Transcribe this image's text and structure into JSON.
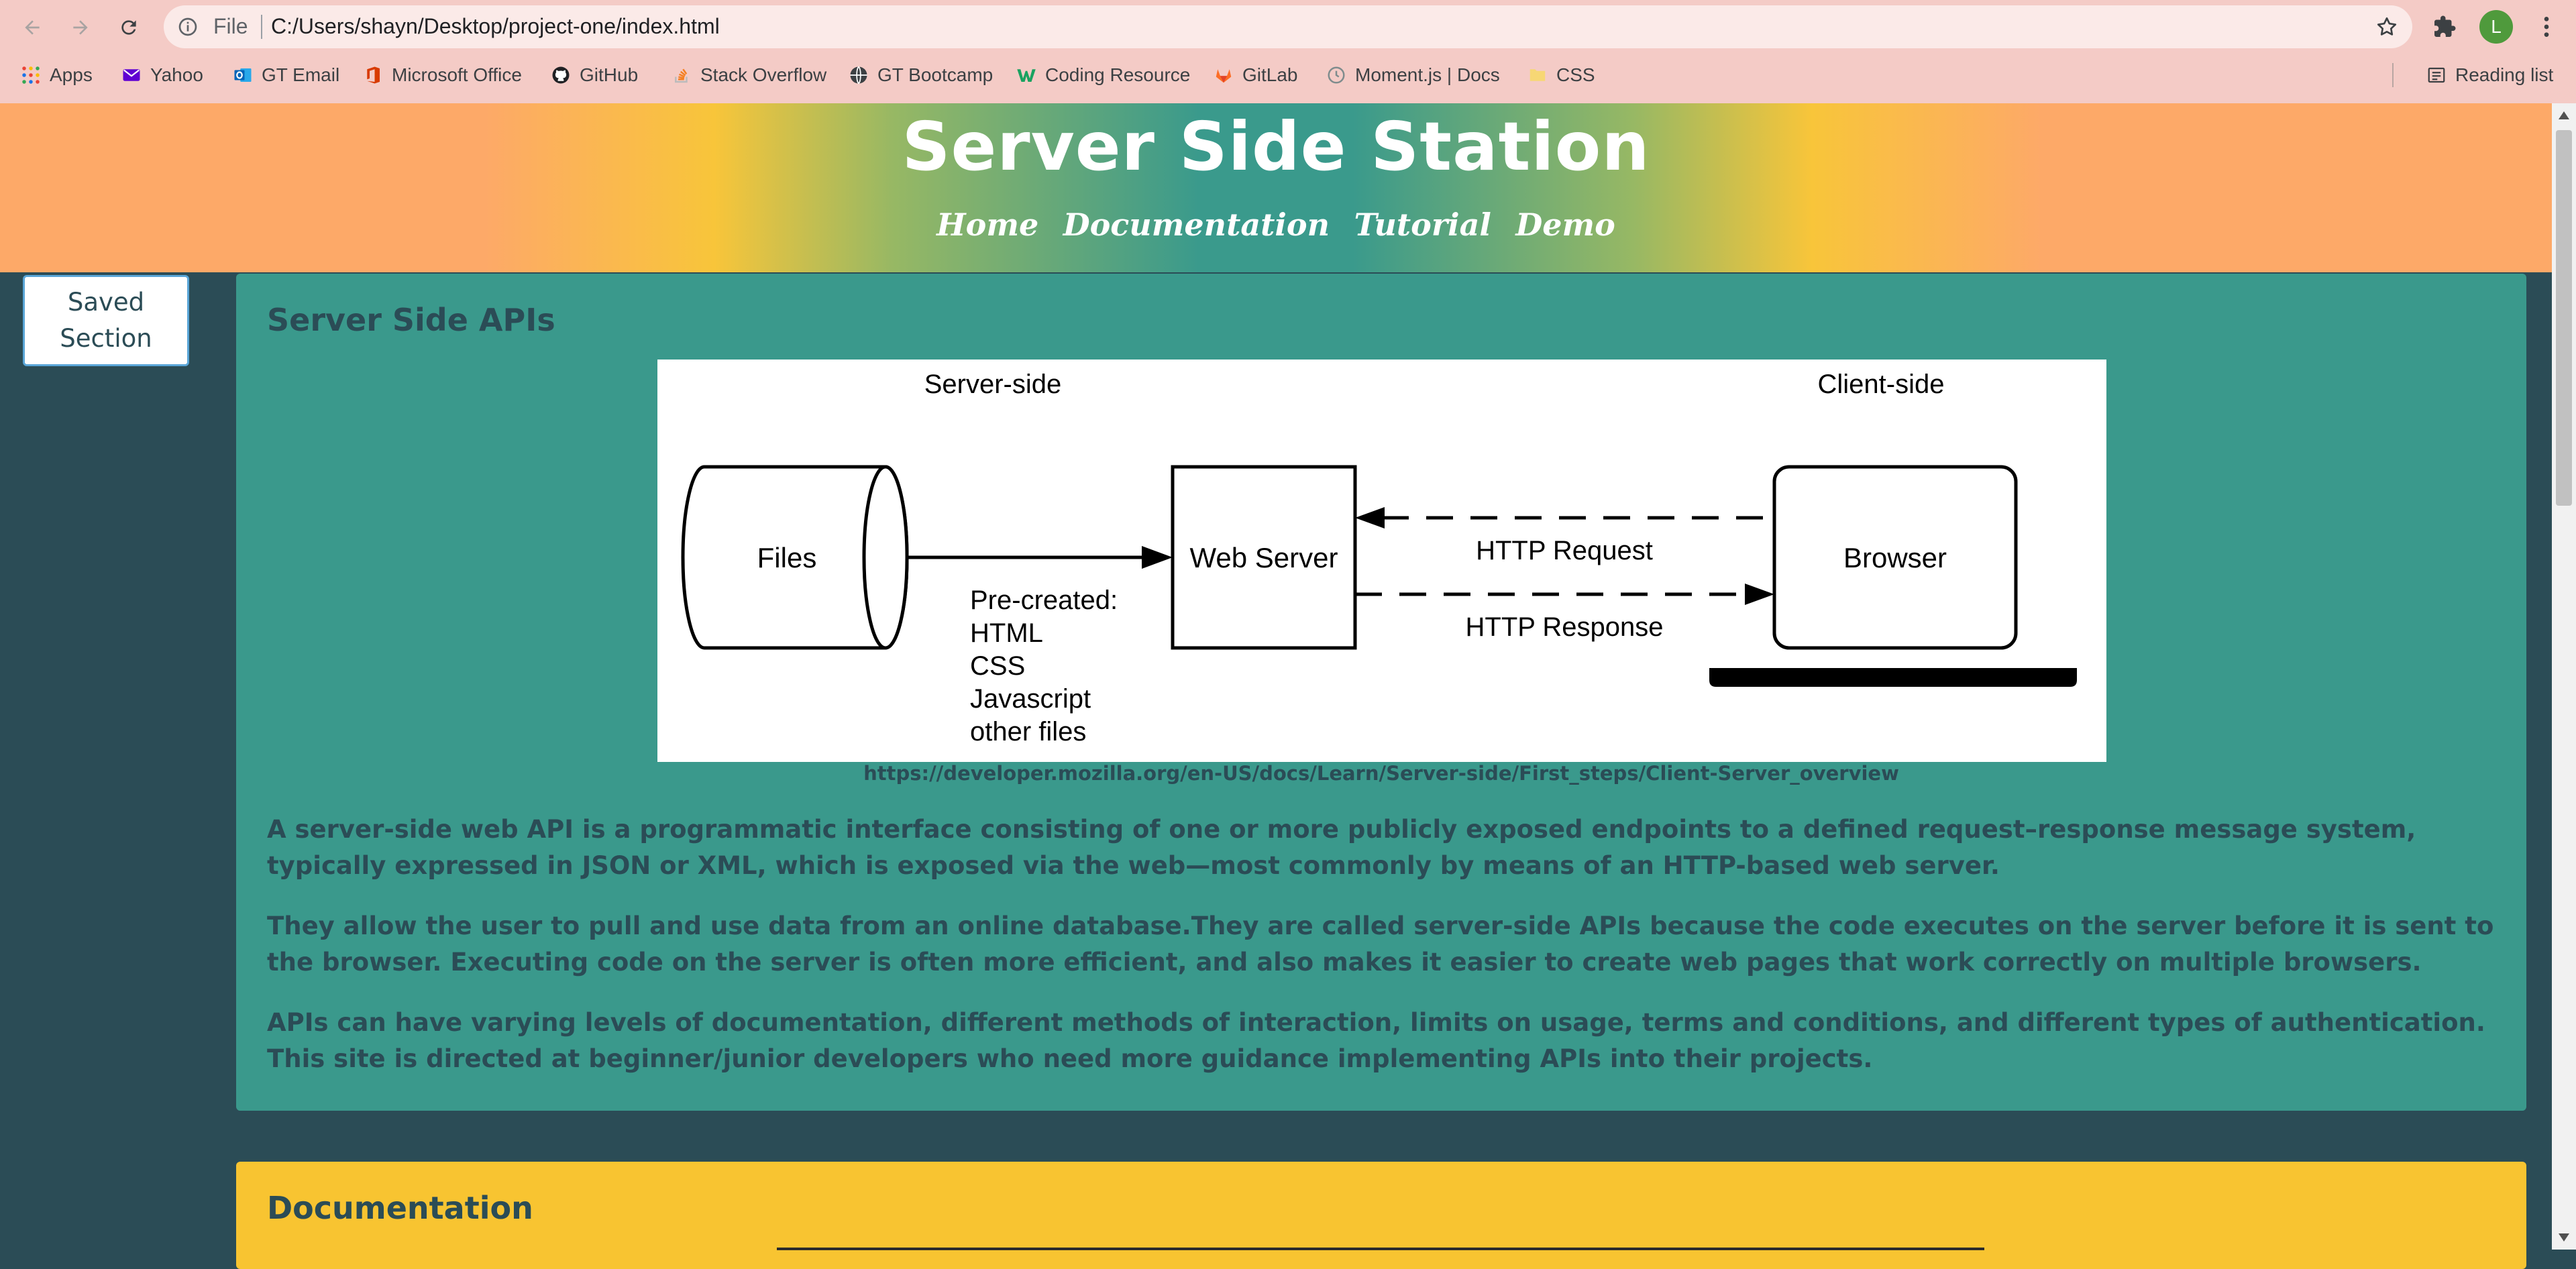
{
  "browser": {
    "scheme_label": "File",
    "url": "C:/Users/shayn/Desktop/project-one/index.html",
    "profile_initial": "L",
    "bookmarks": [
      {
        "label": "Apps",
        "icon": "apps-grid-icon"
      },
      {
        "label": "Yahoo",
        "icon": "yahoo-mail-icon"
      },
      {
        "label": "GT Email",
        "icon": "outlook-icon"
      },
      {
        "label": "Microsoft Office",
        "icon": "office-icon"
      },
      {
        "label": "GitHub",
        "icon": "github-icon"
      },
      {
        "label": "Stack Overflow",
        "icon": "stackoverflow-icon"
      },
      {
        "label": "GT Bootcamp",
        "icon": "globe-icon"
      },
      {
        "label": "Coding Resource",
        "icon": "w-logo-icon"
      },
      {
        "label": "GitLab",
        "icon": "gitlab-icon"
      },
      {
        "label": "Moment.js | Docs",
        "icon": "clock-icon"
      },
      {
        "label": "CSS",
        "icon": "folder-icon"
      }
    ],
    "reading_list_label": "Reading list"
  },
  "header": {
    "title": "Server Side Station",
    "nav": [
      "Home",
      "Documentation",
      "Tutorial",
      "Demo"
    ]
  },
  "sidebar": {
    "saved_line1": "Saved",
    "saved_line2": "Section"
  },
  "main": {
    "title": "Server Side APIs",
    "diagram": {
      "server_label": "Server-side",
      "client_label": "Client-side",
      "files_label": "Files",
      "webserver_label": "Web Server",
      "browser_label": "Browser",
      "request_label": "HTTP Request",
      "response_label": "HTTP Response",
      "precreated_lines": [
        "Pre-created:",
        "HTML",
        "CSS",
        "Javascript",
        "other files"
      ]
    },
    "caption": "https://developer.mozilla.org/en-US/docs/Learn/Server-side/First_steps/Client-Server_overview",
    "paragraphs": [
      "A server-side web API is a programmatic interface consisting of one or more publicly exposed endpoints to a defined request–response message system, typically expressed in JSON or XML, which is exposed via the web—most commonly by means of an HTTP-based web server.",
      "They allow the user to pull and use data from an online database.They are called server-side APIs because the code executes on the server before it is sent to the browser. Executing code on the server is often more efficient, and also makes it easier to create web pages that work correctly on multiple browsers.",
      "APIs can have varying levels of documentation, different methods of interaction, limits on usage, terms and conditions, and different types of authentication. This site is directed at beginner/junior developers who need more guidance implementing APIs into their projects."
    ]
  },
  "documentation": {
    "title": "Documentation"
  },
  "colors": {
    "header_orange": "#fda968",
    "header_yellow": "#f8c53a",
    "header_teal": "#3a9a8c",
    "page_bg": "#2b4c56",
    "card_teal": "#3a998c",
    "card_yellow": "#f8c431",
    "text_dark": "#2b4c56"
  }
}
